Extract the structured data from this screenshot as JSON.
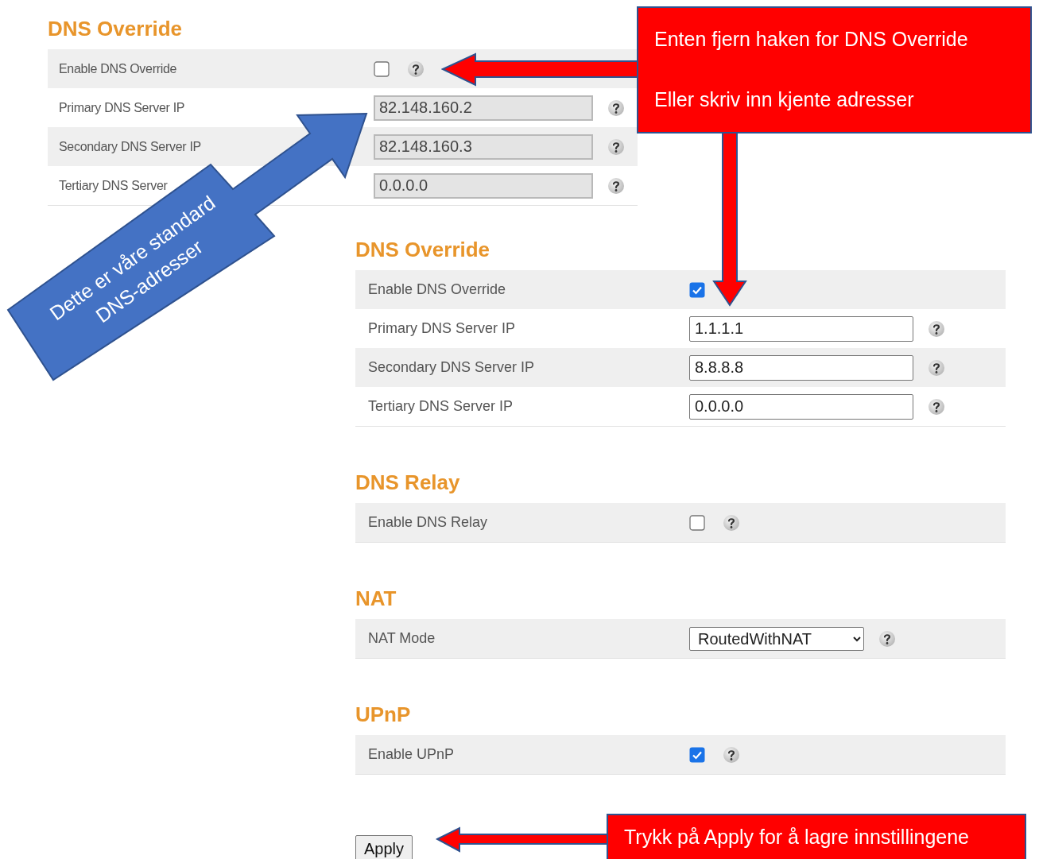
{
  "panels": [
    {
      "sections": [
        {
          "title": "DNS Override",
          "rows": [
            {
              "label": "Enable DNS Override",
              "kind": "checkbox",
              "checked": false
            },
            {
              "label": "Primary DNS Server IP",
              "kind": "text",
              "value": "82.148.160.2",
              "disabled": true
            },
            {
              "label": "Secondary DNS Server IP",
              "kind": "text",
              "value": "82.148.160.3",
              "disabled": true
            },
            {
              "label": "Tertiary DNS Server",
              "kind": "text",
              "value": "0.0.0.0",
              "disabled": true
            }
          ]
        }
      ]
    },
    {
      "sections": [
        {
          "title": "DNS Override",
          "rows": [
            {
              "label": "Enable DNS Override",
              "kind": "checkbox",
              "checked": true
            },
            {
              "label": "Primary DNS Server IP",
              "kind": "text",
              "value": "1.1.1.1",
              "disabled": false
            },
            {
              "label": "Secondary DNS Server IP",
              "kind": "text",
              "value": "8.8.8.8",
              "disabled": false
            },
            {
              "label": "Tertiary DNS Server IP",
              "kind": "text",
              "value": "0.0.0.0",
              "disabled": false
            }
          ]
        },
        {
          "title": "DNS Relay",
          "rows": [
            {
              "label": "Enable DNS Relay",
              "kind": "checkbox",
              "checked": false
            }
          ]
        },
        {
          "title": "NAT",
          "rows": [
            {
              "label": "NAT Mode",
              "kind": "select",
              "value": "RoutedWithNAT"
            }
          ]
        },
        {
          "title": "UPnP",
          "rows": [
            {
              "label": "Enable UPnP",
              "kind": "checkbox",
              "checked": true
            }
          ]
        }
      ],
      "buttons": [
        "Apply"
      ]
    }
  ],
  "top_callout": {
    "lines": [
      "Enten fjern haken for DNS Override",
      "Eller skriv inn kjente adresser"
    ]
  },
  "side_callout": {
    "text": "Dette er våre standard DNS-adresser"
  },
  "bottom_callout": {
    "text": "Trykk på Apply for å lagre innstillingene"
  }
}
